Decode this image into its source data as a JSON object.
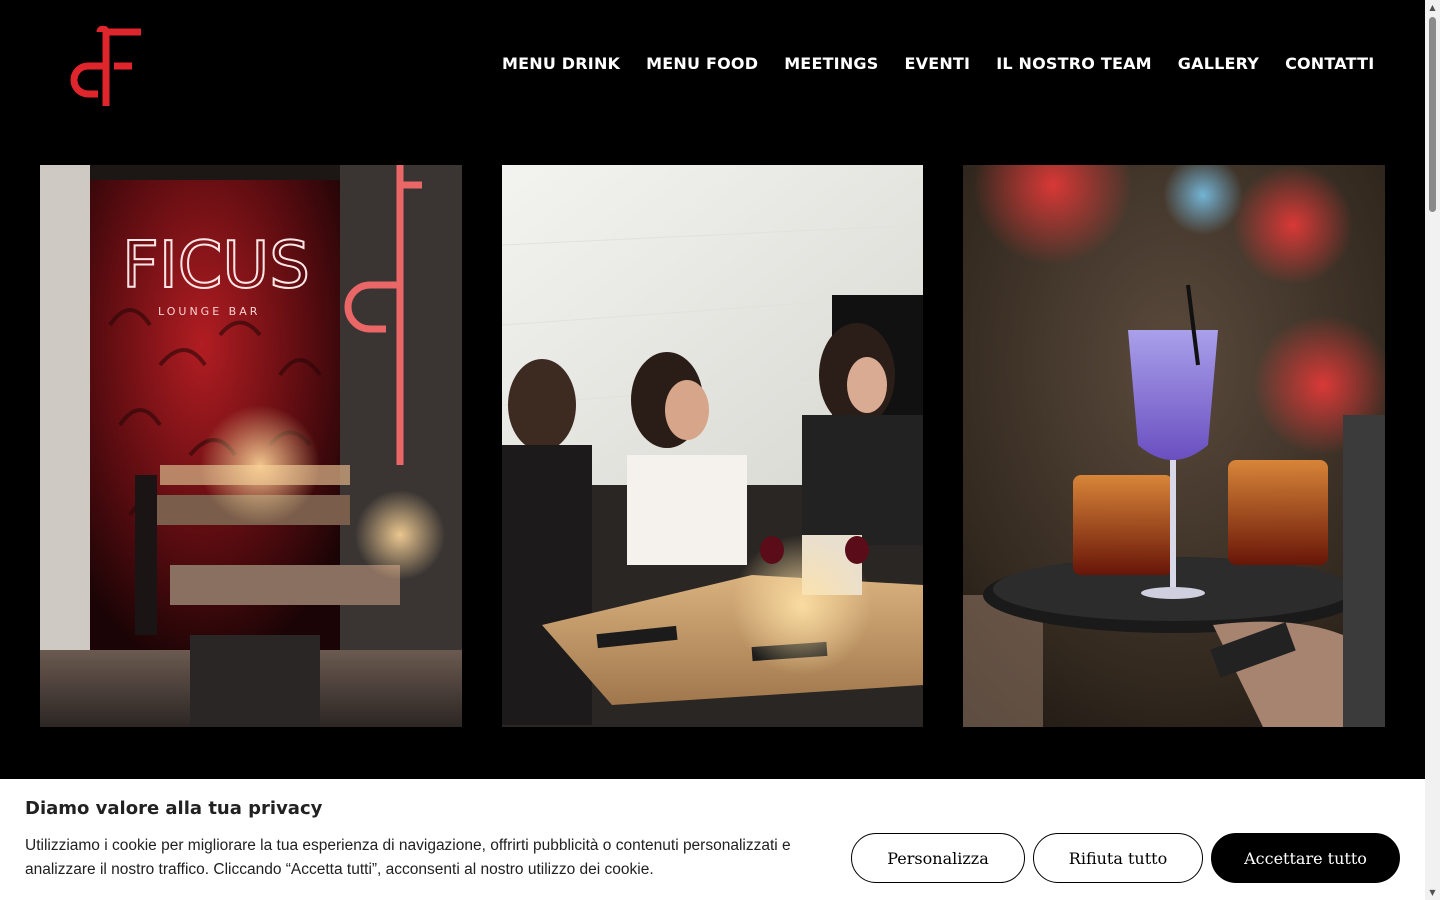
{
  "brand": {
    "logo_icon": "ficus-cf-monogram-icon",
    "accent_color": "#e0262c"
  },
  "nav": {
    "items": [
      {
        "label": "MENU DRINK"
      },
      {
        "label": "MENU FOOD"
      },
      {
        "label": "MEETINGS"
      },
      {
        "label": "EVENTI"
      },
      {
        "label": "IL NOSTRO TEAM"
      },
      {
        "label": "GALLERY"
      },
      {
        "label": "CONTATTI"
      }
    ]
  },
  "gallery": {
    "photos": [
      {
        "subject": "restaurant interior with neon sign",
        "neon_text": "FICUS",
        "neon_subtext": "LOUNGE BAR"
      },
      {
        "subject": "women laughing at dinner table"
      },
      {
        "subject": "waiter holding tray with cocktails"
      }
    ]
  },
  "cookie": {
    "title": "Diamo valore alla tua privacy",
    "text": "Utilizziamo i cookie per migliorare la tua esperienza di navigazione, offrirti pubblicità o contenuti personalizzati e analizzare il nostro traffico. Cliccando “Accetta tutti”, acconsenti al nostro utilizzo dei cookie.",
    "buttons": {
      "customize": "Personalizza",
      "reject": "Rifiuta tutto",
      "accept": "Accettare tutto"
    }
  },
  "scrollbar": {
    "up_icon": "scroll-up-arrow-icon",
    "down_icon": "scroll-down-arrow-icon"
  }
}
